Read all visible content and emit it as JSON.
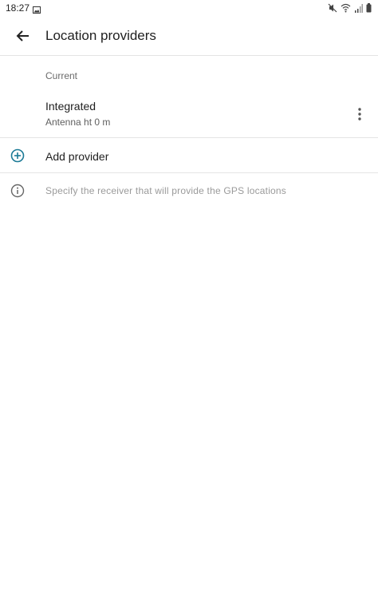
{
  "status_bar": {
    "time": "18:27"
  },
  "app_bar": {
    "title": "Location providers"
  },
  "current_section": {
    "label": "Current"
  },
  "provider": {
    "name": "Integrated",
    "subtitle": "Antenna ht 0 m"
  },
  "add_provider": {
    "label": "Add provider"
  },
  "info": {
    "text": "Specify the receiver that will provide the GPS locations"
  },
  "colors": {
    "accent": "#1b7a96"
  }
}
